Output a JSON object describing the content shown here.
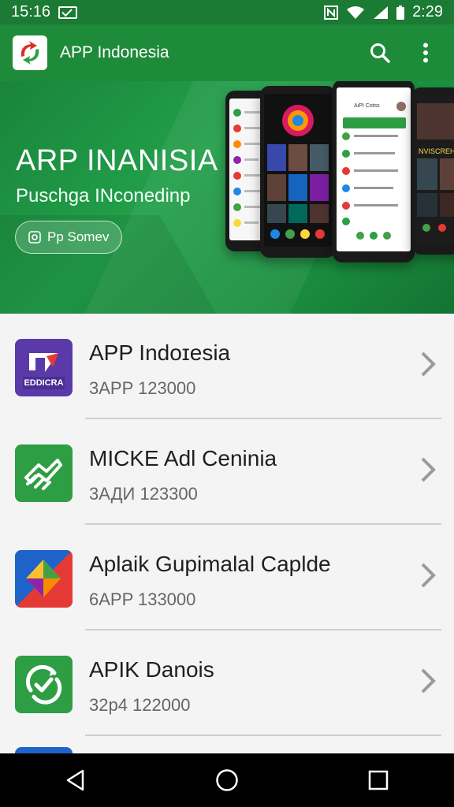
{
  "status_bar": {
    "time": "15:16",
    "clock": "2:29"
  },
  "app_bar": {
    "title": "APP Indonesia"
  },
  "hero": {
    "title": "ARP INANISIA",
    "subtitle": "Puschga INconedinp",
    "button_label": "Pp Somev"
  },
  "phones": {
    "right_header": "AiPI Cotss",
    "right_screen_text": "NVISCREH"
  },
  "list": [
    {
      "title": "APP Indoɪesia",
      "subtitle": "3APP  123000",
      "icon": "edicra-app-icon",
      "icon_text": "EDDICRA"
    },
    {
      "title": "MICKE Adl Ceninia",
      "subtitle": "3АДИ  123300",
      "icon": "green-handshake-app-icon"
    },
    {
      "title": "Aplaik Gupimalal Caplde",
      "subtitle": "6APP  133000",
      "icon": "colorful-diamond-app-icon"
    },
    {
      "title": "APIK Danois",
      "subtitle": "32p4  122000",
      "icon": "green-refresh-check-app-icon"
    }
  ],
  "colors": {
    "appbar": "#1e8b3a",
    "statusbar": "#1b7a33",
    "navbar": "#000000"
  }
}
